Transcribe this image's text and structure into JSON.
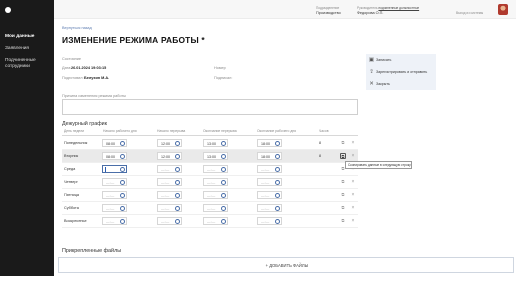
{
  "sidebar": {
    "items": [
      {
        "label": "Мои данные",
        "active": true
      },
      {
        "label": "Заявления",
        "active": false
      },
      {
        "label": "Подчиненные сотрудники",
        "active": false
      }
    ]
  },
  "topbar": {
    "department_label": "Подразделение",
    "department_value": "Производство",
    "manager_label": "Руководитель",
    "manager_link": "подчиненные должностные",
    "manager_value": "Федорова О.П.",
    "exit_label": "Выход из системы"
  },
  "breadcrumb": "Вернуться назад",
  "page_title": "ИЗМЕНЕНИЕ РЕЖИМА РАБОТЫ *",
  "form": {
    "status_label": "Состояние",
    "date_label": "Дата:",
    "date_value": "26.01.2024 19:03:15",
    "number_label": "Номер",
    "author_label": "Подготовил:",
    "author_value": "Белухин М.А.",
    "signer_label": "Подписал:",
    "reason_label": "Причина изменения режима работы"
  },
  "actions": [
    {
      "icon": "save-icon",
      "glyph": "▣",
      "label": "Записать"
    },
    {
      "icon": "upload-icon",
      "glyph": "⇪",
      "label": "Зарегистрировать и отправить"
    },
    {
      "icon": "close-icon",
      "glyph": "✕",
      "label": "Закрыть"
    }
  ],
  "schedule": {
    "section_title": "Дежурный график",
    "columns": [
      "День недели",
      "Начало рабочего дня",
      "Начало перерыва",
      "Окончание перерыва",
      "Окончание рабочего дня",
      "Часов"
    ],
    "rows": [
      {
        "day": "Понедельник",
        "start": "08:00",
        "break_start": "12:00",
        "break_end": "13:00",
        "end": "18:00",
        "hours": "8"
      },
      {
        "day": "Вторник",
        "start": "08:00",
        "break_start": "12:00",
        "break_end": "13:00",
        "end": "18:00",
        "hours": "8"
      },
      {
        "day": "Среда",
        "start": "",
        "break_start": "—:—",
        "break_end": "—:—",
        "end": "—:—",
        "hours": ""
      },
      {
        "day": "Четверг",
        "start": "—:—",
        "break_start": "—:—",
        "break_end": "—:—",
        "end": "—:—",
        "hours": ""
      },
      {
        "day": "Пятница",
        "start": "—:—",
        "break_start": "—:—",
        "break_end": "—:—",
        "end": "—:—",
        "hours": ""
      },
      {
        "day": "Суббота",
        "start": "—:—",
        "break_start": "—:—",
        "break_end": "—:—",
        "end": "—:—",
        "hours": ""
      },
      {
        "day": "Воскресенье",
        "start": "—:—",
        "break_start": "—:—",
        "break_end": "—:—",
        "end": "—:—",
        "hours": ""
      }
    ],
    "tooltip": "Скопировать данные в следующую строку"
  },
  "files": {
    "section_title": "Прикрепленные файлы",
    "add_button": "+ ДОБАВИТЬ ФАЙЛЫ"
  },
  "colors": {
    "sidebar_bg": "#1a1a1a",
    "accent": "#4a6ea8",
    "actions_bg": "#eef2f8"
  }
}
